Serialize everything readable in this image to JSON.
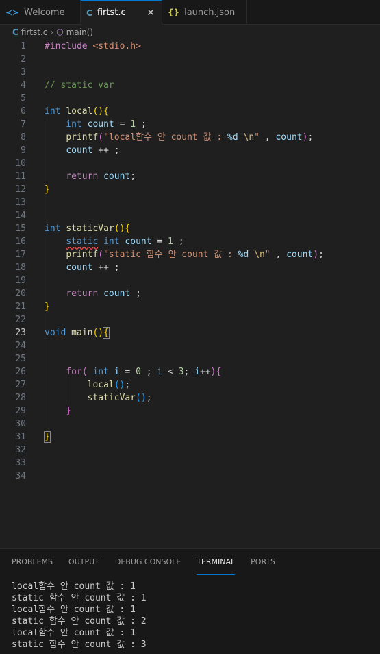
{
  "tabs": [
    {
      "label": "Welcome",
      "icon": "vscode-logo-icon"
    },
    {
      "label": "firtst.c",
      "icon": "c-file-icon",
      "active": true,
      "close": "✕"
    },
    {
      "label": "launch.json",
      "icon": "json-file-icon"
    }
  ],
  "breadcrumb": {
    "file": "firtst.c",
    "symbol": "main()"
  },
  "editor": {
    "line_numbers": [
      "1",
      "2",
      "3",
      "4",
      "5",
      "6",
      "7",
      "8",
      "9",
      "10",
      "11",
      "12",
      "13",
      "14",
      "15",
      "16",
      "17",
      "18",
      "19",
      "20",
      "21",
      "22",
      "23",
      "24",
      "25",
      "26",
      "27",
      "28",
      "29",
      "30",
      "31",
      "32",
      "33",
      "34"
    ],
    "current_line": "23",
    "code": {
      "l1_pp": "#include",
      "l1_inc": " <stdio.h>",
      "l4": "// static var",
      "l6_kw": "int",
      "l6_fn": "local",
      "l7_kw": "int",
      "l7_var": "count",
      "l7_num": "1",
      "l8_fn": "printf",
      "l8_str1": "\"local함수 안 count 값 : ",
      "l8_fmt": "%d",
      "l8_esc": "\\n",
      "l8_str2": "\"",
      "l8_var": "count",
      "l9_var": "count",
      "l11_kw": "return",
      "l11_var": "count",
      "l15_kw": "int",
      "l15_fn": "staticVar",
      "l16_kw1": "static",
      "l16_kw2": "int",
      "l16_var": "count",
      "l16_num": "1",
      "l17_fn": "printf",
      "l17_str1": "\"static 함수 안 count 값 : ",
      "l17_fmt": "%d",
      "l17_esc": "\\n",
      "l17_str2": "\"",
      "l17_var": "count",
      "l18_var": "count",
      "l20_kw": "return",
      "l20_var": "count",
      "l23_kw": "void",
      "l23_fn": "main",
      "l26_kw": "for",
      "l26_int": "int",
      "l26_i": "i",
      "l26_n0": "0",
      "l26_i2": "i",
      "l26_n3": "3",
      "l26_i3": "i",
      "l27_fn": "local",
      "l28_fn": "staticVar"
    }
  },
  "panel": {
    "tabs": [
      "PROBLEMS",
      "OUTPUT",
      "DEBUG CONSOLE",
      "TERMINAL",
      "PORTS"
    ],
    "active_tab": "TERMINAL",
    "terminal_lines": [
      "local함수 안 count 값 : 1",
      "static 함수 안 count 값 : 1",
      "local함수 안 count 값 : 1",
      "static 함수 안 count 값 : 2",
      "local함수 안 count 값 : 1",
      "static 함수 안 count 값 : 3"
    ]
  }
}
